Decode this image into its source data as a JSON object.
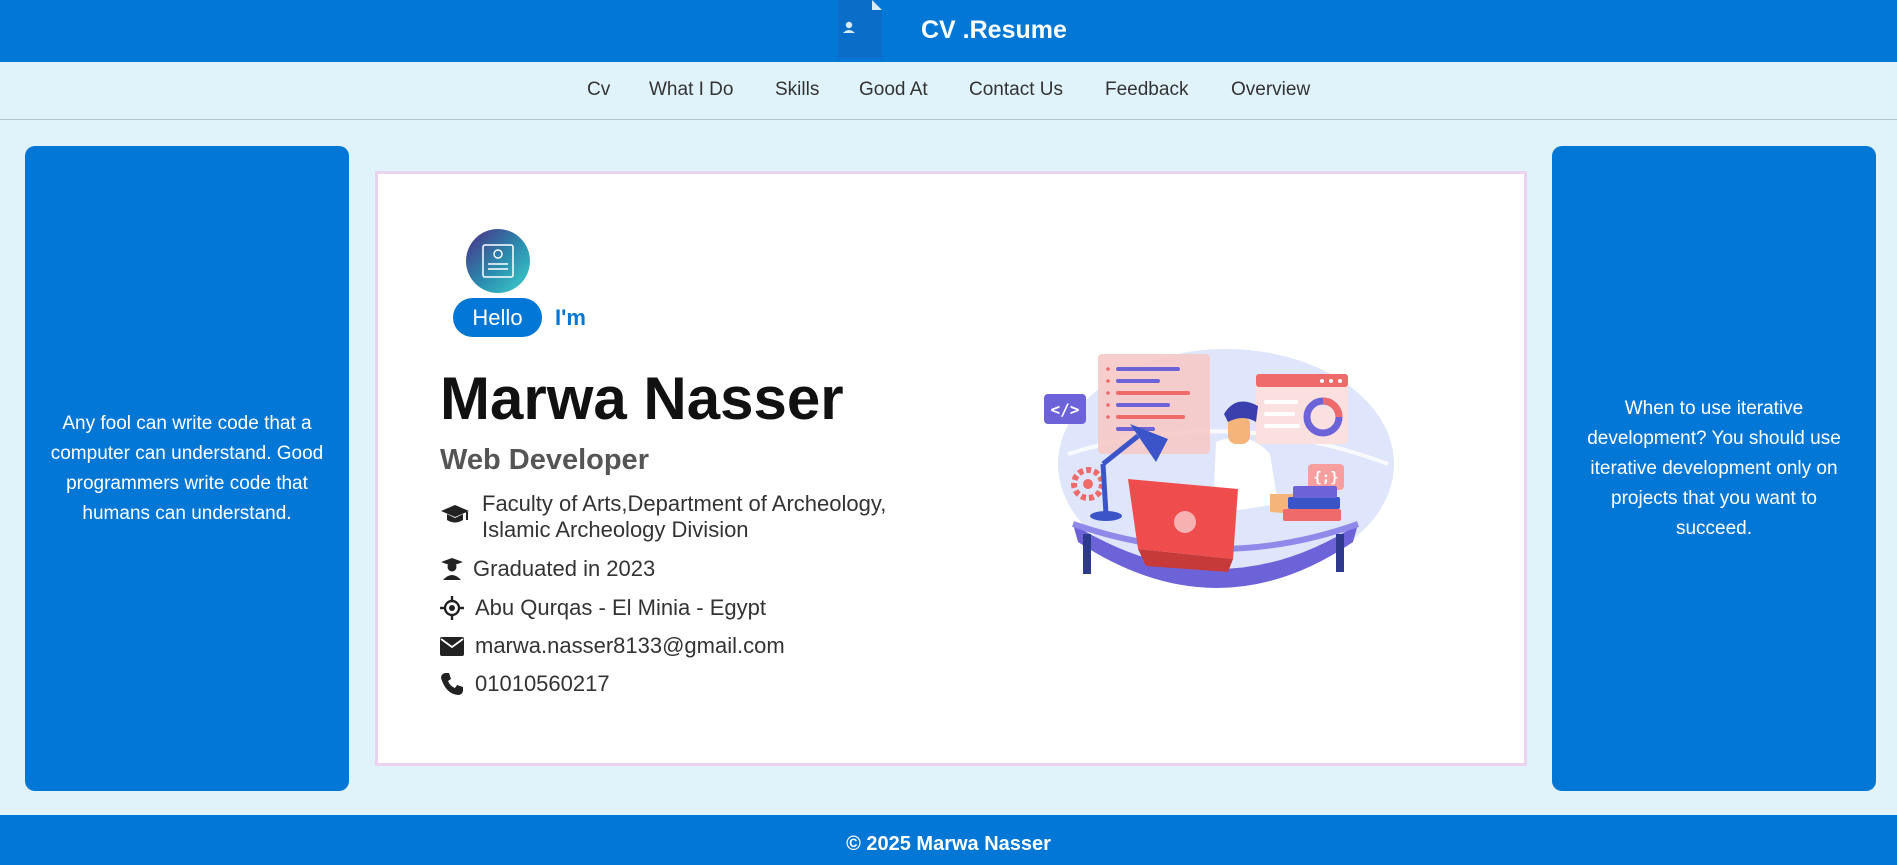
{
  "header": {
    "brand": "CV .Resume",
    "logo_icon": "resume-document-icon"
  },
  "nav": {
    "items": [
      "Cv",
      "What I Do",
      "Skills",
      "Good At",
      "Contact Us",
      "Feedback",
      "Overview"
    ]
  },
  "left_panel": {
    "quote": "Any fool can write code that a computer can understand. Good programmers write code that humans can understand."
  },
  "right_panel": {
    "quote": "When to use iterative development? You should use iterative development only on projects that you want to succeed."
  },
  "profile": {
    "hello": "Hello",
    "im": "I'm",
    "name": "Marwa Nasser",
    "role": "Web Developer",
    "education_line1": "Faculty of Arts,Department of Archeology,",
    "education_line2": "Islamic Archeology Division",
    "graduated": "Graduated in 2023",
    "location": "Abu Qurqas - El Minia - Egypt",
    "email": "marwa.nasser8133@gmail.com",
    "phone": "01010560217"
  },
  "illustration": {
    "code_tag": "</>",
    "braces_tag": "{;}"
  },
  "footer": {
    "text": "© 2025 Marwa Nasser"
  },
  "colors": {
    "primary": "#0277d6",
    "background": "#e0f3fb",
    "card_border": "#ead3ee"
  }
}
